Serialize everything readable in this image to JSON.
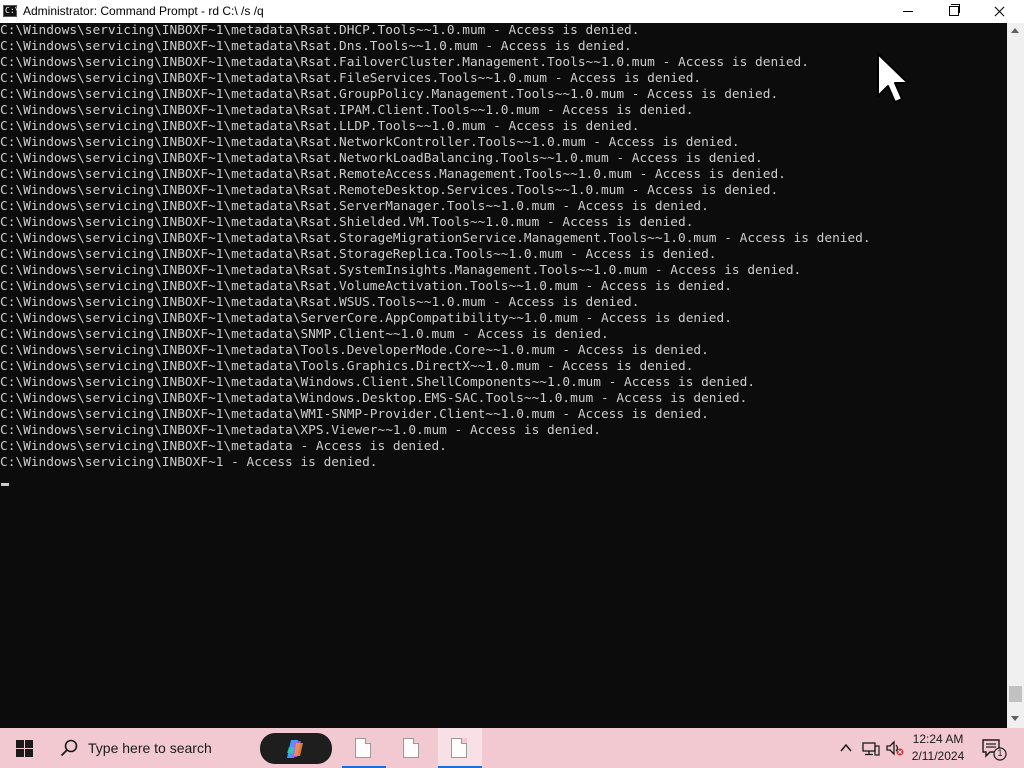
{
  "window": {
    "title": "Administrator: Command Prompt - rd  C:\\ /s /q",
    "app_icon_text": "C:\\"
  },
  "console": {
    "lines": [
      "C:\\Windows\\servicing\\INBOXF~1\\metadata\\Rsat.DHCP.Tools~~1.0.mum - Access is denied.",
      "C:\\Windows\\servicing\\INBOXF~1\\metadata\\Rsat.Dns.Tools~~1.0.mum - Access is denied.",
      "C:\\Windows\\servicing\\INBOXF~1\\metadata\\Rsat.FailoverCluster.Management.Tools~~1.0.mum - Access is denied.",
      "C:\\Windows\\servicing\\INBOXF~1\\metadata\\Rsat.FileServices.Tools~~1.0.mum - Access is denied.",
      "C:\\Windows\\servicing\\INBOXF~1\\metadata\\Rsat.GroupPolicy.Management.Tools~~1.0.mum - Access is denied.",
      "C:\\Windows\\servicing\\INBOXF~1\\metadata\\Rsat.IPAM.Client.Tools~~1.0.mum - Access is denied.",
      "C:\\Windows\\servicing\\INBOXF~1\\metadata\\Rsat.LLDP.Tools~~1.0.mum - Access is denied.",
      "C:\\Windows\\servicing\\INBOXF~1\\metadata\\Rsat.NetworkController.Tools~~1.0.mum - Access is denied.",
      "C:\\Windows\\servicing\\INBOXF~1\\metadata\\Rsat.NetworkLoadBalancing.Tools~~1.0.mum - Access is denied.",
      "C:\\Windows\\servicing\\INBOXF~1\\metadata\\Rsat.RemoteAccess.Management.Tools~~1.0.mum - Access is denied.",
      "C:\\Windows\\servicing\\INBOXF~1\\metadata\\Rsat.RemoteDesktop.Services.Tools~~1.0.mum - Access is denied.",
      "C:\\Windows\\servicing\\INBOXF~1\\metadata\\Rsat.ServerManager.Tools~~1.0.mum - Access is denied.",
      "C:\\Windows\\servicing\\INBOXF~1\\metadata\\Rsat.Shielded.VM.Tools~~1.0.mum - Access is denied.",
      "C:\\Windows\\servicing\\INBOXF~1\\metadata\\Rsat.StorageMigrationService.Management.Tools~~1.0.mum - Access is denied.",
      "C:\\Windows\\servicing\\INBOXF~1\\metadata\\Rsat.StorageReplica.Tools~~1.0.mum - Access is denied.",
      "C:\\Windows\\servicing\\INBOXF~1\\metadata\\Rsat.SystemInsights.Management.Tools~~1.0.mum - Access is denied.",
      "C:\\Windows\\servicing\\INBOXF~1\\metadata\\Rsat.VolumeActivation.Tools~~1.0.mum - Access is denied.",
      "C:\\Windows\\servicing\\INBOXF~1\\metadata\\Rsat.WSUS.Tools~~1.0.mum - Access is denied.",
      "C:\\Windows\\servicing\\INBOXF~1\\metadata\\ServerCore.AppCompatibility~~1.0.mum - Access is denied.",
      "C:\\Windows\\servicing\\INBOXF~1\\metadata\\SNMP.Client~~1.0.mum - Access is denied.",
      "C:\\Windows\\servicing\\INBOXF~1\\metadata\\Tools.DeveloperMode.Core~~1.0.mum - Access is denied.",
      "C:\\Windows\\servicing\\INBOXF~1\\metadata\\Tools.Graphics.DirectX~~1.0.mum - Access is denied.",
      "C:\\Windows\\servicing\\INBOXF~1\\metadata\\Windows.Client.ShellComponents~~1.0.mum - Access is denied.",
      "C:\\Windows\\servicing\\INBOXF~1\\metadata\\Windows.Desktop.EMS-SAC.Tools~~1.0.mum - Access is denied.",
      "C:\\Windows\\servicing\\INBOXF~1\\metadata\\WMI-SNMP-Provider.Client~~1.0.mum - Access is denied.",
      "C:\\Windows\\servicing\\INBOXF~1\\metadata\\XPS.Viewer~~1.0.mum - Access is denied.",
      "C:\\Windows\\servicing\\INBOXF~1\\metadata - Access is denied.",
      "C:\\Windows\\servicing\\INBOXF~1 - Access is denied."
    ]
  },
  "taskbar": {
    "search_placeholder": "Type here to search",
    "pinned_apps": [
      {
        "icon": "document-icon",
        "active": true
      },
      {
        "icon": "document-icon",
        "active": false
      },
      {
        "icon": "document-icon",
        "active": true
      }
    ],
    "clock_time": "12:24 AM",
    "clock_date": "2/11/2024",
    "notification_count": "1"
  },
  "colors": {
    "console_background": "#0c0c0c",
    "console_text": "#cccccc",
    "taskbar_background": "#f2c9d1",
    "accent": "#1a6fd8"
  }
}
